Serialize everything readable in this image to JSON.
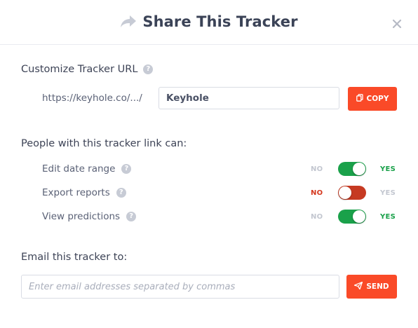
{
  "dialog": {
    "title": "Share This Tracker",
    "accent_color": "#fa4a28"
  },
  "url_section": {
    "label": "Customize Tracker URL",
    "prefix": "https://keyhole.co/.../",
    "slug_value": "Keyhole",
    "copy_label": "COPY"
  },
  "permissions": {
    "heading": "People with this tracker link can:",
    "no_label": "NO",
    "yes_label": "YES",
    "items": [
      {
        "label": "Edit date range",
        "enabled": true
      },
      {
        "label": "Export reports",
        "enabled": false
      },
      {
        "label": "View predictions",
        "enabled": true
      }
    ]
  },
  "email_section": {
    "heading": "Email this tracker to:",
    "placeholder": "Enter email addresses separated by commas",
    "value": "",
    "send_label": "SEND"
  }
}
